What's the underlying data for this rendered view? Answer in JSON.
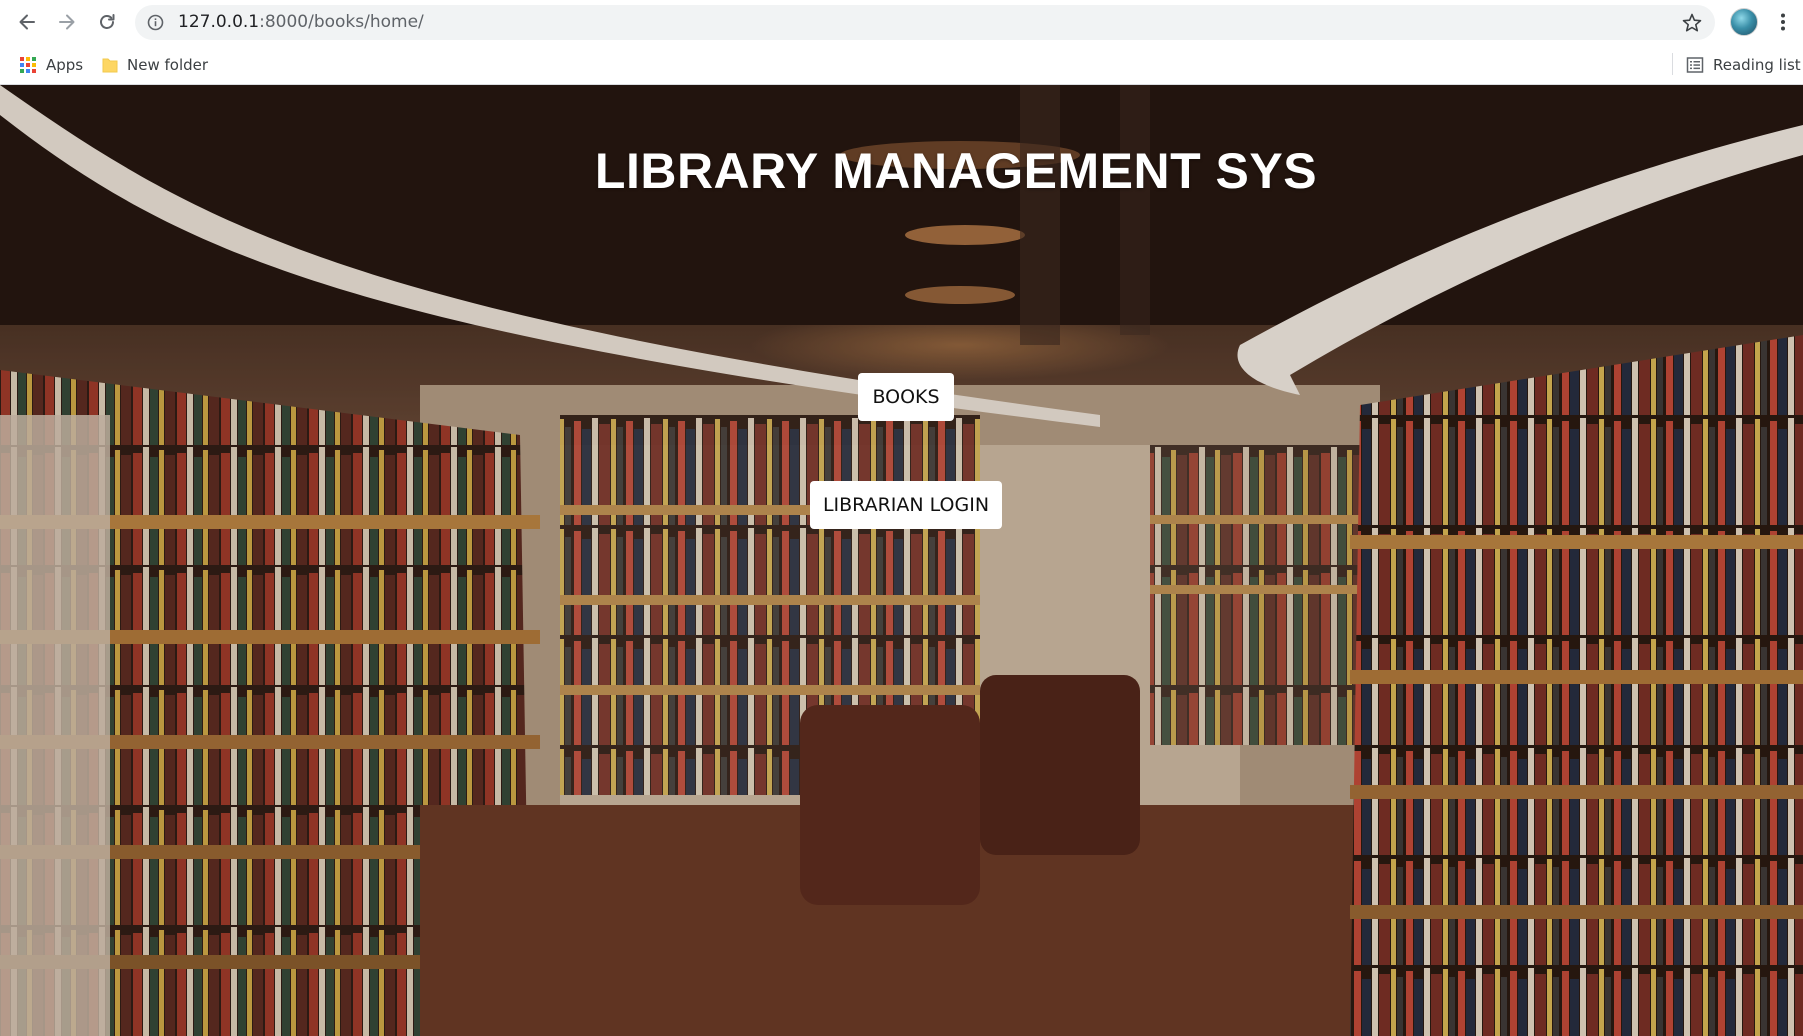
{
  "browser": {
    "url_host": "127.0.0.1",
    "url_path": ":8000/books/home/",
    "bookmarks": {
      "apps_label": "Apps",
      "folder_label": "New folder",
      "reading_list_label": "Reading list"
    }
  },
  "page": {
    "title": "LIBRARY MANAGEMENT SYS",
    "books_button": "BOOKS",
    "librarian_login_button": "LIBRARIAN LOGIN"
  }
}
